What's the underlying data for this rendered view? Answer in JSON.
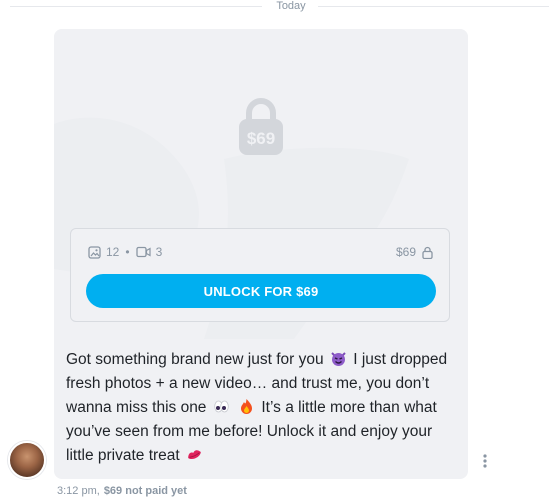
{
  "separator": {
    "label": "Today"
  },
  "locked_post": {
    "price_icon_text": "$69",
    "photo_count": "12",
    "video_count": "3",
    "price": "$69",
    "unlock_label": "UNLOCK FOR $69"
  },
  "message": {
    "line1_a": "Got something brand new just for you",
    "line1_b": " I just dropped fresh photos + a new video… and trust me, you don’t wanna miss this one",
    "line2": " It’s a little more than what you’ve seen from me before! Unlock it and enjoy your little private treat",
    "emoji": [
      "devil-emoji",
      "eyes-emoji",
      "fire-emoji",
      "lips-emoji"
    ]
  },
  "meta": {
    "time": "3:12 pm,",
    "status": "$69 not paid yet"
  },
  "colors": {
    "accent": "#00aff0",
    "muted": "#8a96a3",
    "bubble": "#f0f1f4"
  }
}
